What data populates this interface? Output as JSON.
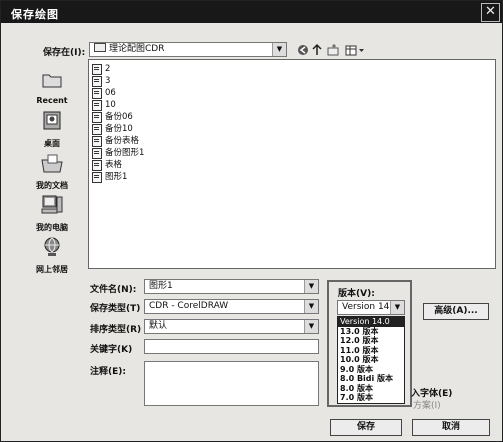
{
  "window": {
    "title": "保存绘图",
    "close_glyph": "✕"
  },
  "save_in": {
    "label": "保存在(I):",
    "value": "理论配图CDR"
  },
  "toolbar": [
    "back-icon",
    "up-folder-icon",
    "new-folder-icon",
    "view-menu-icon"
  ],
  "places": [
    {
      "label": "Recent",
      "icon": "recent-icon"
    },
    {
      "label": "桌面",
      "icon": "desktop-icon"
    },
    {
      "label": "我的文档",
      "icon": "documents-icon"
    },
    {
      "label": "我的电脑",
      "icon": "computer-icon"
    },
    {
      "label": "网上邻居",
      "icon": "network-icon"
    }
  ],
  "files": [
    "2",
    "3",
    "06",
    "10",
    "备份06",
    "备份10",
    "备份表格",
    "备份图形1",
    "表格",
    "图形1"
  ],
  "form": {
    "filename_label": "文件名(N):",
    "filename_value": "图形1",
    "savetype_label": "保存类型(T)",
    "savetype_value": "CDR - CorelDRAW",
    "sort_label": "排序类型(R)",
    "sort_value": "默认",
    "keywords_label": "关键字(K)",
    "notes_label": "注释(E):"
  },
  "version": {
    "label": "版本(V):",
    "selected": "Version 14.0",
    "options": [
      "Version 14.0",
      "13.0 版本",
      "12.0 版本",
      "11.0 版本",
      "10.0 版本",
      "9.0 版本",
      "8.0 Bidi 版本",
      "8.0 版本",
      "7.0 版本"
    ]
  },
  "partial": {
    "embed_fonts": "入字体(E)",
    "scheme": "方案(I)"
  },
  "buttons": {
    "advanced": "高级(A)...",
    "save": "保存",
    "cancel": "取消"
  }
}
